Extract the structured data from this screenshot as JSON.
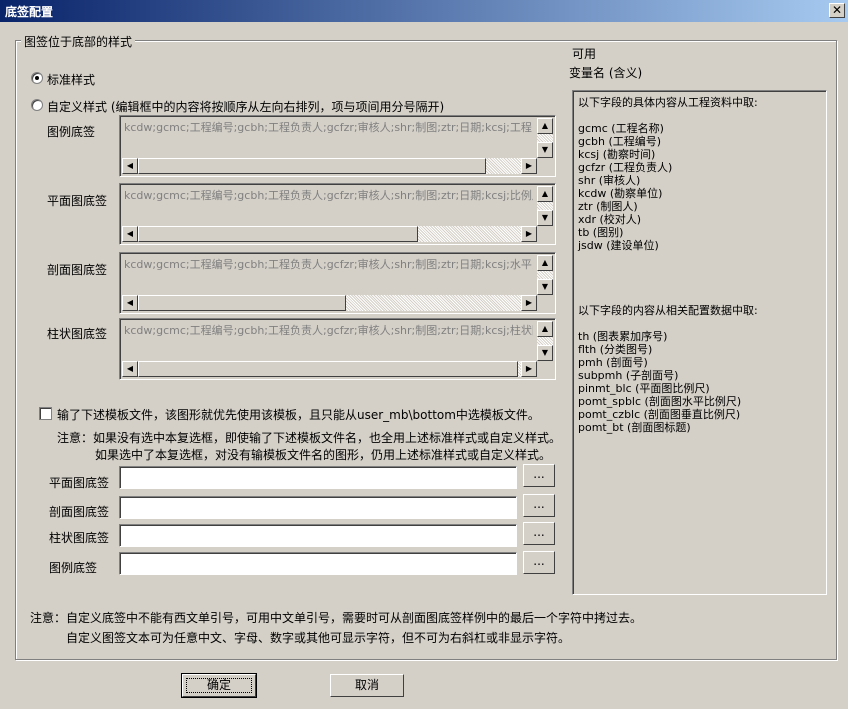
{
  "window": {
    "title": "底签配置",
    "close_label": "✕"
  },
  "group": {
    "legend": "图签位于底部的样式"
  },
  "standard_style": {
    "label": "标准样式",
    "selected": true
  },
  "custom_style": {
    "label": "自定义样式 (编辑框中的内容将按顺序从左向右排列，项与项间用分号隔开)",
    "selected": false
  },
  "custom_fields": [
    {
      "label": "图例底签",
      "value": "kcdw;gcmc;工程编号;gcbh;工程负责人;gcfzr;审核人;shr;制图;ztr;日期;kcsj;工程"
    },
    {
      "label": "平面图底签",
      "value": "kcdw;gcmc;工程编号;gcbh;工程负责人;gcfzr;审核人;shr;制图;ztr;日期;kcsj;比例尺"
    },
    {
      "label": "剖面图底签",
      "value": "kcdw;gcmc;工程编号;gcbh;工程负责人;gcfzr;审核人;shr;制图;ztr;日期;kcsj;水平比"
    },
    {
      "label": "柱状图底签",
      "value": "kcdw;gcmc;工程编号;gcbh;工程负责人;gcfzr;审核人;shr;制图;ztr;日期;kcsj;柱状图"
    }
  ],
  "template": {
    "checkbox_label": "输了下述模板文件，该图形就优先使用该模板，且只能从user_mb\\bottom中选模板文件。",
    "checked": false,
    "note1": "注意：如果没有选中本复选框，即使输了下述模板文件名，也全用上述标准样式或自定义样式。",
    "note2": "如果选中了本复选框，对没有输模板文件名的图形，仍用上述标准样式或自定义样式。",
    "browse_label": "...",
    "files": [
      {
        "label": "平面图底签",
        "value": ""
      },
      {
        "label": "剖面图底签",
        "value": ""
      },
      {
        "label": "柱状图底签",
        "value": ""
      },
      {
        "label": "图例底签",
        "value": ""
      }
    ]
  },
  "variables": {
    "header1": "可用",
    "header2": "变量名 (含义)",
    "section1_title": "以下字段的具体内容从工程资料中取:",
    "section1_items": [
      "gcmc (工程名称)",
      "gcbh (工程编号)",
      "kcsj (勘察时间)",
      "gcfzr (工程负责人)",
      "shr (审核人)",
      "kcdw (勘察单位)",
      "ztr (制图人)",
      "xdr (校对人)",
      "tb (图别)",
      "jsdw (建设单位)"
    ],
    "section2_title": "以下字段的内容从相关配置数据中取:",
    "section2_items": [
      "th (图表累加序号)",
      "flth (分类图号)",
      "pmh (剖面号)",
      "subpmh (子剖面号)",
      "pinmt_blc (平面图比例尺)",
      "pomt_spblc (剖面图水平比例尺)",
      "pomt_czblc (剖面图垂直比例尺)",
      "pomt_bt (剖面图标题)"
    ]
  },
  "footer_note": {
    "line1": "注意：自定义底签中不能有西文单引号，可用中文单引号，需要时可从剖面图底签样例中的最后一个字符中拷过去。",
    "line2": "自定义图签文本可为任意中文、字母、数字或其他可显示字符，但不可为右斜杠或非显示字符。"
  },
  "buttons": {
    "ok": "确定",
    "cancel": "取消"
  }
}
